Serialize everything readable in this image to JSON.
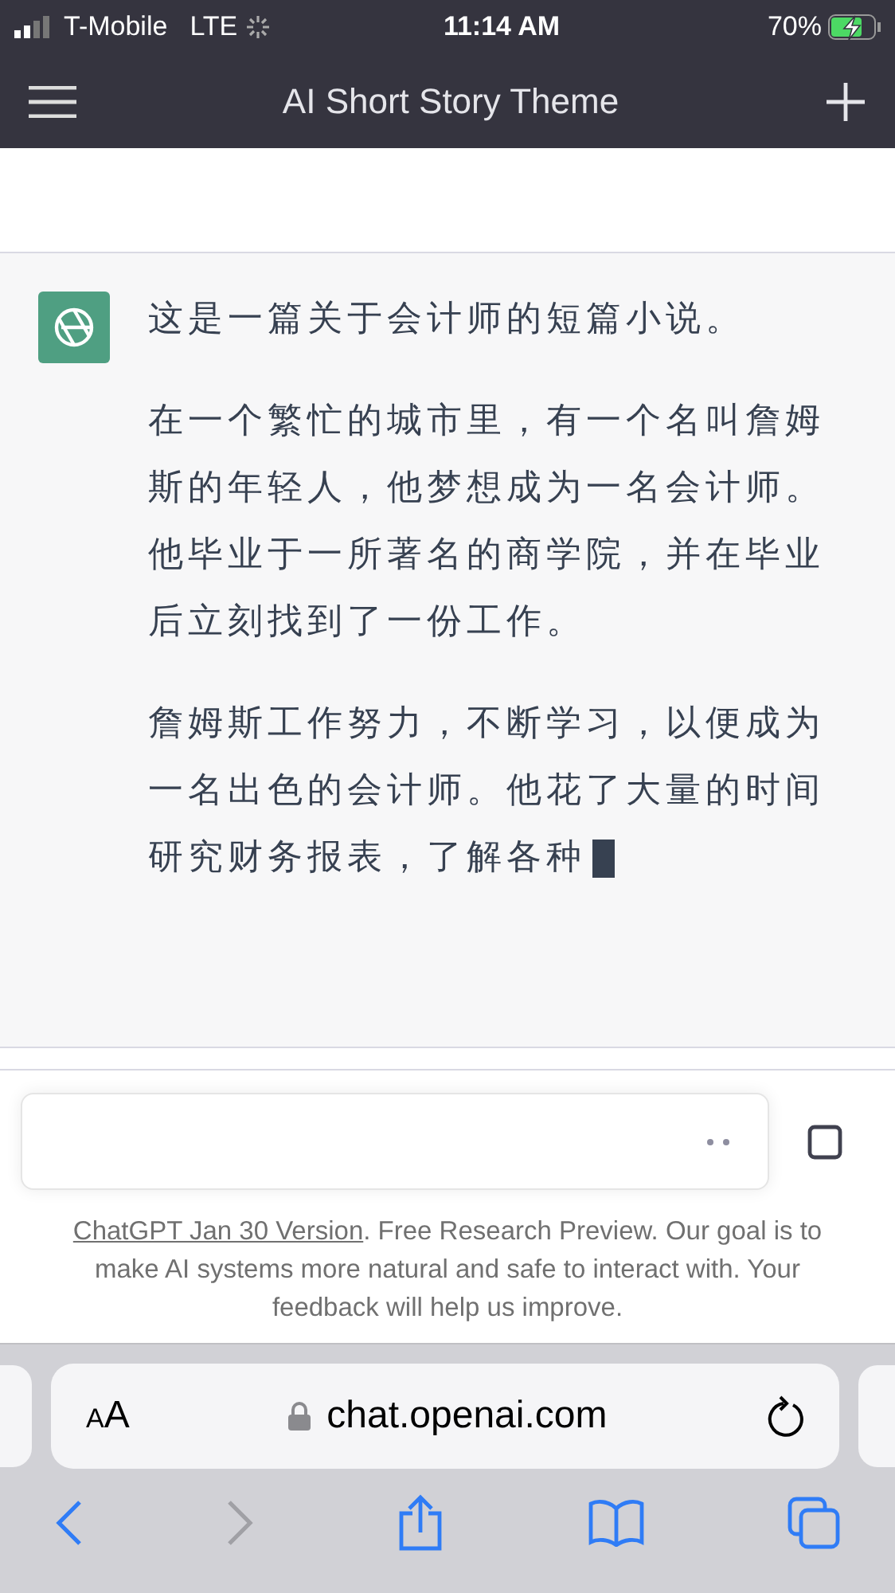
{
  "status_bar": {
    "carrier": "T-Mobile",
    "network": "LTE",
    "time": "11:14 AM",
    "battery": "70%"
  },
  "header": {
    "title": "AI Short Story Theme"
  },
  "message": {
    "paragraphs": [
      "这是一篇关于会计师的短篇小说。",
      "在一个繁忙的城市里，有一个名叫詹姆斯的年轻人，他梦想成为一名会计师。他毕业于一所著名的商学院，并在毕业后立刻找到了一份工作。",
      "詹姆斯工作努力，不断学习，以便成为一名出色的会计师。他花了大量的时间研究财务报表，了解各种"
    ],
    "streaming": true
  },
  "footer": {
    "link": "ChatGPT Jan 30 Version",
    "text": ". Free Research Preview. Our goal is to make AI systems more natural and safe to interact with. Your feedback will help us improve."
  },
  "browser": {
    "text_size": "AA",
    "url": "chat.openai.com",
    "forward_disabled": true
  }
}
